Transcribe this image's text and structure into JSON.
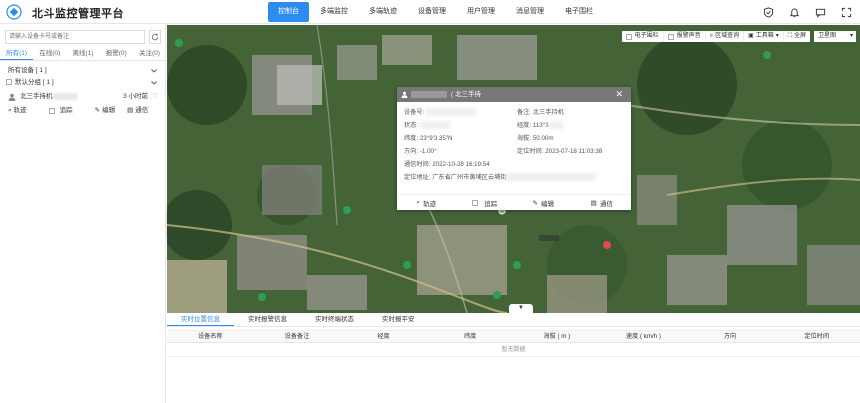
{
  "header": {
    "title": "北斗监控管理平台",
    "nav": [
      "控制台",
      "多端监控",
      "多端轨迹",
      "设备管理",
      "用户管理",
      "消息管理",
      "电子围栏"
    ],
    "active_nav": 0,
    "icons": [
      "shield-icon",
      "bell-icon",
      "message-icon",
      "expand-icon"
    ]
  },
  "sidebar": {
    "search_placeholder": "请输入设备卡号或备注",
    "filter_tabs": [
      "所有(1)",
      "在线(0)",
      "离线(1)",
      "报警(0)",
      "关注(0)"
    ],
    "all_devices": "所有设备 [ 1 ]",
    "default_group": "默认分组 [ 1 ]",
    "device": {
      "name": "北三手持机",
      "time": "3 小时前"
    },
    "actions": [
      "轨迹",
      "追踪",
      "编辑",
      "通信"
    ]
  },
  "map": {
    "toolbar": [
      "电子围栏",
      "报警声音",
      "区域查询",
      "工具箱",
      "全屏"
    ],
    "map_type": "卫星图",
    "popup": {
      "title_suffix": "( 北三手持",
      "fields": [
        {
          "label": "设备号:",
          "value": ""
        },
        {
          "label": "备注:",
          "value": "北三手持机"
        },
        {
          "label": "状态:",
          "value": "离线"
        },
        {
          "label": "经度:",
          "value": "113°3"
        },
        {
          "label": "纬度:",
          "value": "23°9'3.35\"N"
        },
        {
          "label": "海拔:",
          "value": "50.00m"
        },
        {
          "label": "方向:",
          "value": "-1.00°"
        },
        {
          "label": "定位时间:",
          "value": "2023-07-18 11:03:38"
        }
      ],
      "comm_time": "通信时间: 2022-10-28 16:19:54",
      "address": "定位地址: 广东省广州市黄埔区云埔街",
      "actions": [
        "轨迹",
        "追踪",
        "编辑",
        "通信"
      ]
    }
  },
  "bottom": {
    "tabs": [
      "实时位置信息",
      "实时报警信息",
      "实时终端状态",
      "实时报平安"
    ],
    "columns": [
      "设备名称",
      "设备备注",
      "经度",
      "纬度",
      "海拔 ( m )",
      "速度 ( km/h )",
      "方向",
      "定位时间"
    ],
    "empty_text": "暂无数据"
  },
  "colors": {
    "accent": "#2d8cf0",
    "popup_header": "#777777"
  }
}
